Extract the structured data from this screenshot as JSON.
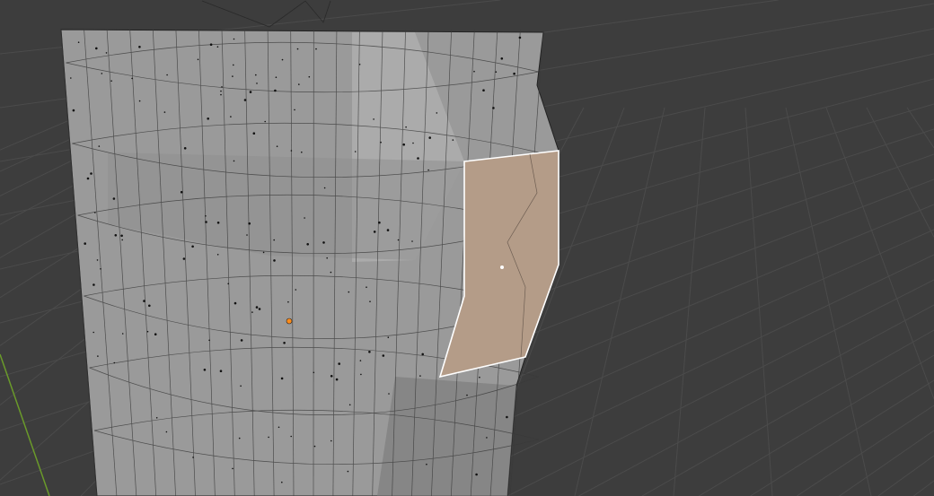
{
  "viewport": {
    "background_color": "#3d3d3d",
    "grid_color": "#4a4a4a",
    "mesh_color": "#9c9c9c",
    "mesh_light_color": "#b4b4b4",
    "selected_face_color": "#b49c88",
    "selected_edge_color": "#ffffff",
    "origin_color": "#ff8c1a",
    "y_axis_color": "#6a9a2a"
  }
}
